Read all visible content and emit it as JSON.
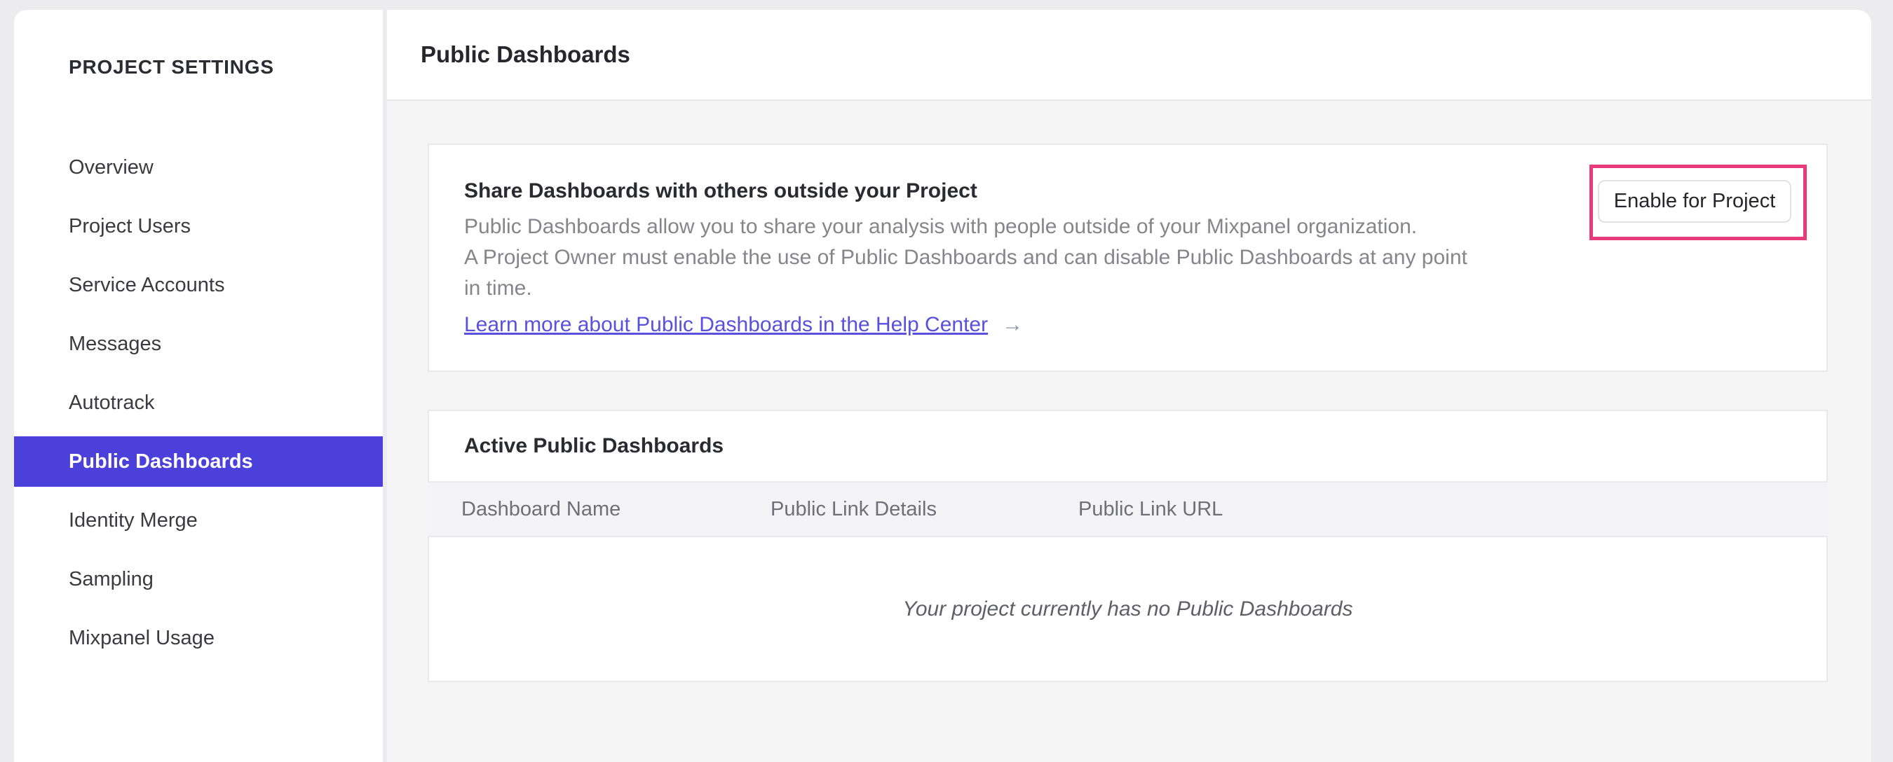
{
  "sidebar": {
    "title": "PROJECT SETTINGS",
    "items": [
      {
        "label": "Overview",
        "selected": false
      },
      {
        "label": "Project Users",
        "selected": false
      },
      {
        "label": "Service Accounts",
        "selected": false
      },
      {
        "label": "Messages",
        "selected": false
      },
      {
        "label": "Autotrack",
        "selected": false
      },
      {
        "label": "Public Dashboards",
        "selected": true
      },
      {
        "label": "Identity Merge",
        "selected": false
      },
      {
        "label": "Sampling",
        "selected": false
      },
      {
        "label": "Mixpanel Usage",
        "selected": false
      }
    ]
  },
  "header": {
    "title": "Public Dashboards"
  },
  "share_card": {
    "heading": "Share Dashboards with others outside your Project",
    "description_lines": [
      "Public Dashboards allow you to share your analysis with people outside of your Mixpanel organization.",
      "A Project Owner must enable the use of Public Dashboards and can disable Public Dashboards at any point",
      "in time."
    ],
    "link_label": "Learn more about Public Dashboards in the Help Center",
    "arrow_icon": "→",
    "enable_button_label": "Enable for Project"
  },
  "dashboards_card": {
    "title": "Active Public Dashboards",
    "columns": [
      "Dashboard Name",
      "Public Link Details",
      "Public Link URL"
    ],
    "rows": [],
    "empty_message": "Your project currently has no Public Dashboards"
  },
  "colors": {
    "selected_nav_background": "#4C40DA",
    "annotation_highlight": "#E83B7D",
    "link": "#5A50DD"
  }
}
